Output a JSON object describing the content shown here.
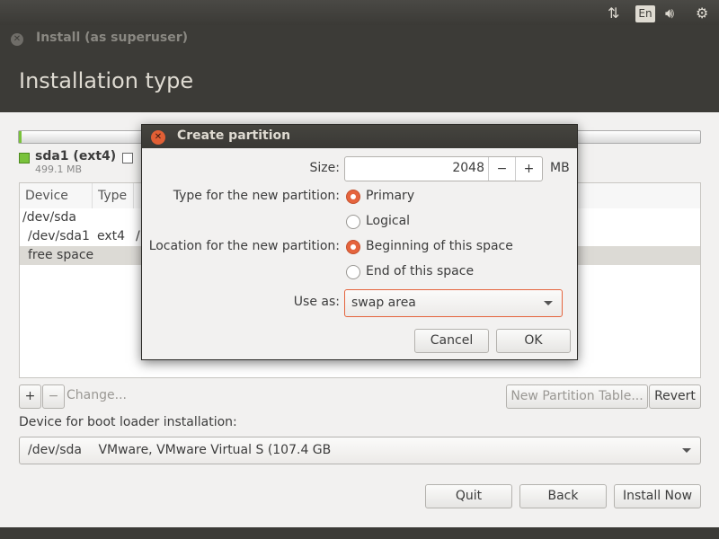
{
  "panel": {
    "network_icon": "network-arrows-icon",
    "keyboard": "En",
    "sound_icon": "speaker-icon",
    "power_icon": "gear-icon"
  },
  "window": {
    "title": "Install (as superuser)",
    "page_title": "Installation type"
  },
  "partition_bar": {
    "legend": [
      {
        "name": "sda1 (ext4)",
        "size": "499.1 MB",
        "color": "#79c23b"
      }
    ]
  },
  "table": {
    "headers": [
      "Device",
      "Type"
    ],
    "rows": [
      {
        "device": "/dev/sda",
        "type": "",
        "extra": ""
      },
      {
        "device": "/dev/sda1",
        "type": "ext4",
        "extra": "/"
      },
      {
        "device": "free space",
        "type": "",
        "extra": ""
      }
    ]
  },
  "actions": {
    "add": "+",
    "remove": "−",
    "change": "Change...",
    "new_table": "New Partition Table...",
    "revert": "Revert"
  },
  "boot": {
    "label": "Device for boot loader installation:",
    "device": "/dev/sda",
    "desc": "VMware, VMware Virtual S (107.4 GB"
  },
  "nav": {
    "quit": "Quit",
    "back": "Back",
    "install": "Install Now"
  },
  "dialog": {
    "title": "Create partition",
    "size_label": "Size:",
    "size_value": "2048",
    "minus": "−",
    "plus": "+",
    "unit": "MB",
    "type_label": "Type for the new partition:",
    "type_options": [
      "Primary",
      "Logical"
    ],
    "type_selected": "Primary",
    "location_label": "Location for the new partition:",
    "location_options": [
      "Beginning of this space",
      "End of this space"
    ],
    "location_selected": "Beginning of this space",
    "use_label": "Use as:",
    "use_value": "swap area",
    "cancel": "Cancel",
    "ok": "OK",
    "accent": "#e5643d"
  }
}
